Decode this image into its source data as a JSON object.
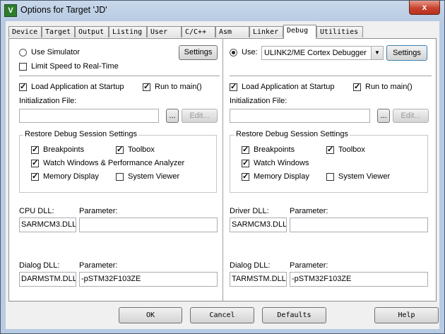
{
  "window": {
    "title": "Options for Target 'JD'",
    "close_label": "x",
    "app_icon_letter": "V"
  },
  "tabs": [
    {
      "label": "Device"
    },
    {
      "label": "Target"
    },
    {
      "label": "Output"
    },
    {
      "label": "Listing"
    },
    {
      "label": "User"
    },
    {
      "label": "C/C++"
    },
    {
      "label": "Asm"
    },
    {
      "label": "Linker"
    },
    {
      "label": "Debug",
      "active": true
    },
    {
      "label": "Utilities"
    }
  ],
  "left": {
    "use_simulator": "Use Simulator",
    "limit_speed": "Limit Speed to Real-Time",
    "settings": "Settings",
    "load_app": "Load Application at Startup",
    "run_to_main": "Run to main()",
    "init_file_label": "Initialization File:",
    "browse": "...",
    "edit": "Edit...",
    "restore_group": "Restore Debug Session Settings",
    "breakpoints": "Breakpoints",
    "toolbox": "Toolbox",
    "watch": "Watch Windows & Performance Analyzer",
    "memory": "Memory Display",
    "system_viewer": "System Viewer",
    "dll_label": "CPU DLL:",
    "param_label": "Parameter:",
    "dll_value": "SARMCM3.DLL",
    "param_value": "",
    "dialog_dll_label": "Dialog DLL:",
    "dialog_param_label": "Parameter:",
    "dialog_dll_value": "DARMSTM.DLL",
    "dialog_param_value": "-pSTM32F103ZE"
  },
  "right": {
    "use": "Use:",
    "debugger": "ULINK2/ME Cortex Debugger",
    "settings": "Settings",
    "load_app": "Load Application at Startup",
    "run_to_main": "Run to main()",
    "init_file_label": "Initialization File:",
    "browse": "...",
    "edit": "Edit...",
    "restore_group": "Restore Debug Session Settings",
    "breakpoints": "Breakpoints",
    "toolbox": "Toolbox",
    "watch": "Watch Windows",
    "memory": "Memory Display",
    "system_viewer": "System Viewer",
    "dll_label": "Driver DLL:",
    "param_label": "Parameter:",
    "dll_value": "SARMCM3.DLL",
    "param_value": "",
    "dialog_dll_label": "Dialog DLL:",
    "dialog_param_label": "Parameter:",
    "dialog_dll_value": "TARMSTM.DLL",
    "dialog_param_value": "-pSTM32F103ZE"
  },
  "buttons": {
    "ok": "OK",
    "cancel": "Cancel",
    "defaults": "Defaults",
    "help": "Help"
  }
}
